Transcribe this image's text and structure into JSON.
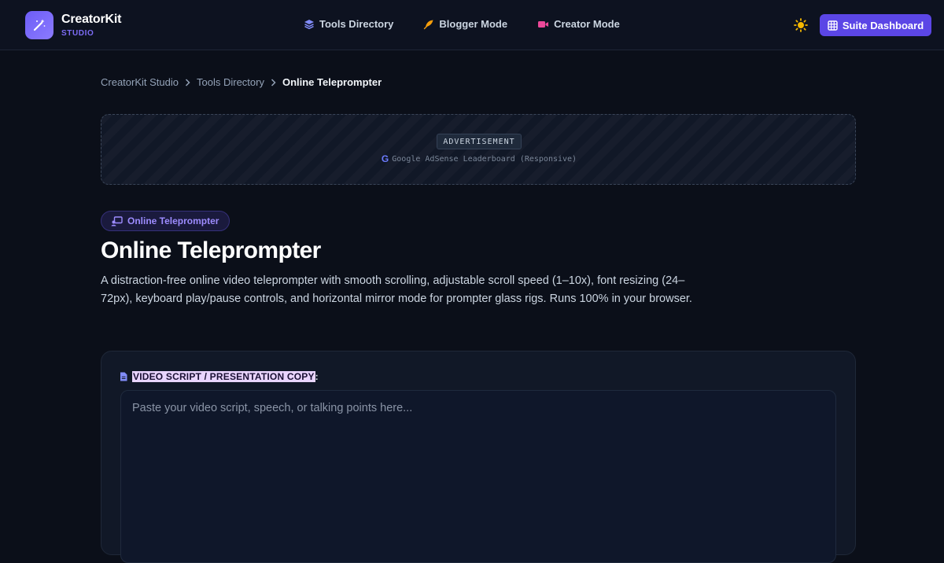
{
  "header": {
    "brand_name": "CreatorKit",
    "brand_sub": "STUDIO",
    "nav": [
      {
        "label": "Tools Directory",
        "icon": "layers-icon",
        "color": "#818cf8"
      },
      {
        "label": "Blogger Mode",
        "icon": "feather-icon",
        "color": "#f59e0b"
      },
      {
        "label": "Creator Mode",
        "icon": "video-icon",
        "color": "#ec4899"
      }
    ],
    "theme_icon": "sun-icon",
    "dashboard_button": "Suite Dashboard"
  },
  "breadcrumb": {
    "items": [
      "CreatorKit Studio",
      "Tools Directory"
    ],
    "current": "Online Teleprompter"
  },
  "ad": {
    "label": "ADVERTISEMENT",
    "text": "Google AdSense Leaderboard (Responsive)"
  },
  "tool": {
    "badge": "Online Teleprompter",
    "title": "Online Teleprompter",
    "description": "A distraction-free online video teleprompter with smooth scrolling, adjustable scroll speed (1–10x), font resizing (24–72px), keyboard play/pause controls, and horizontal mirror mode for prompter glass rigs. Runs 100% in your browser."
  },
  "editor": {
    "label": "VIDEO SCRIPT / PRESENTATION COPY",
    "label_suffix": ":",
    "placeholder": "Paste your video script, speech, or talking points here...",
    "value": ""
  },
  "colors": {
    "accent": "#5b46e6",
    "background": "#0b0f19",
    "card": "#111827"
  }
}
